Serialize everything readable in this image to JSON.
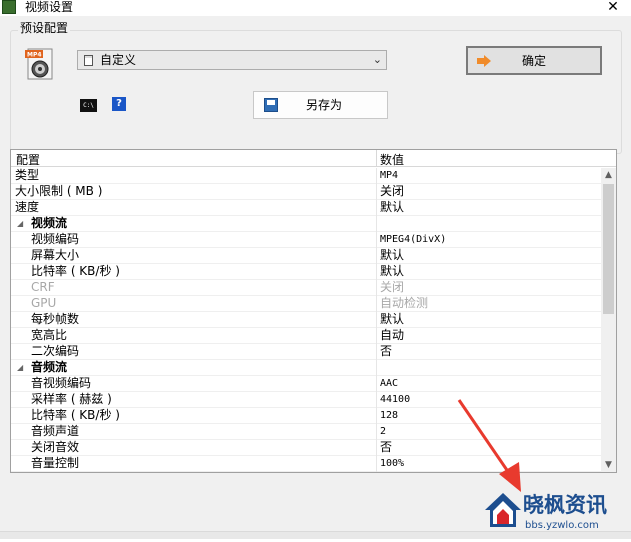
{
  "window": {
    "title": "视频设置",
    "close_glyph": "✕"
  },
  "preset": {
    "group_label": "预设配置",
    "combo_value": "自定义",
    "ok_label": "确定",
    "saveas_label": "另存为",
    "cmd_icon_text": "C:\\",
    "help_icon_text": "?",
    "icon_badge": "MP4"
  },
  "grid": {
    "col_config": "配置",
    "col_value": "数值",
    "rows": [
      {
        "key": "类型",
        "value": "MP4",
        "mono": true
      },
      {
        "key": "大小限制 ( MB )",
        "value": "关闭"
      },
      {
        "key": "速度",
        "value": "默认"
      },
      {
        "key": "视频流",
        "category": true
      },
      {
        "key": "视频编码",
        "value": "MPEG4(DivX)",
        "mono": true
      },
      {
        "key": "屏幕大小",
        "value": "默认"
      },
      {
        "key": "比特率 ( KB/秒 )",
        "value": "默认"
      },
      {
        "key": "CRF",
        "value": "关闭",
        "disabled": true
      },
      {
        "key": "GPU",
        "value": "自动检测",
        "disabled": true
      },
      {
        "key": "每秒帧数",
        "value": "默认"
      },
      {
        "key": "宽高比",
        "value": "自动"
      },
      {
        "key": "二次编码",
        "value": "否"
      },
      {
        "key": "音频流",
        "category": true
      },
      {
        "key": "音视频编码",
        "value": "AAC",
        "mono": true
      },
      {
        "key": "采样率 ( 赫兹 )",
        "value": "44100",
        "mono": true
      },
      {
        "key": "比特率 ( KB/秒 )",
        "value": "128",
        "mono": true
      },
      {
        "key": "音频声道",
        "value": "2",
        "mono": true
      },
      {
        "key": "关闭音效",
        "value": "否"
      },
      {
        "key": "音量控制",
        "value": "100%",
        "mono": true
      }
    ]
  },
  "watermark": {
    "brand": "晓枫资讯",
    "url": "bbs.yzwlo.com"
  },
  "colors": {
    "accent_arrow": "#e83a2e",
    "watermark_blue": "#1d4e8f",
    "watermark_red": "#d9262b"
  }
}
